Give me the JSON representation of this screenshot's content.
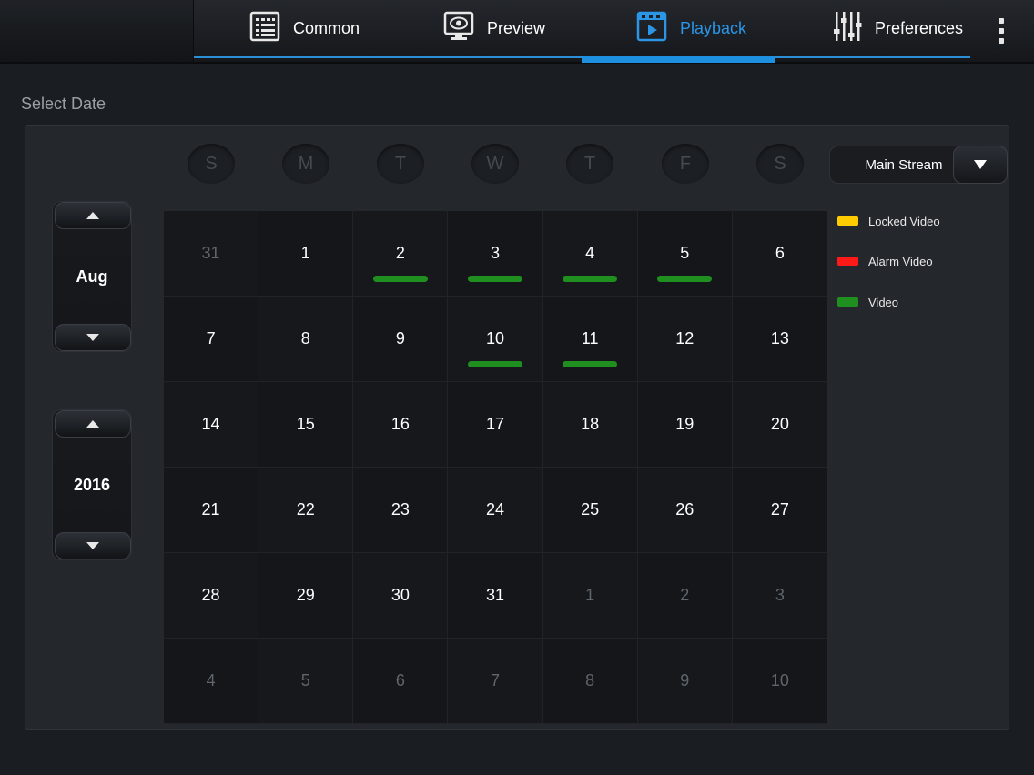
{
  "nav": {
    "tabs": [
      {
        "label": "Common",
        "icon": "grid-list-icon",
        "active": false
      },
      {
        "label": "Preview",
        "icon": "monitor-eye-icon",
        "active": false
      },
      {
        "label": "Playback",
        "icon": "film-play-icon",
        "active": true
      },
      {
        "label": "Preferences",
        "icon": "sliders-icon",
        "active": false
      }
    ],
    "more_icon": "more-vertical-icon"
  },
  "page": {
    "section_label": "Select Date"
  },
  "month_picker": {
    "value": "Aug"
  },
  "year_picker": {
    "value": "2016"
  },
  "weekdays": [
    "S",
    "M",
    "T",
    "W",
    "T",
    "F",
    "S"
  ],
  "stream_select": {
    "value": "Main Stream"
  },
  "legend": [
    {
      "label": "Locked Video",
      "color": "#ffcc00"
    },
    {
      "label": "Alarm Video",
      "color": "#ff1a1a"
    },
    {
      "label": "Video",
      "color": "#1f8f1f"
    }
  ],
  "calendar": {
    "days": [
      {
        "n": "31",
        "other": true
      },
      {
        "n": "1"
      },
      {
        "n": "2",
        "rec": "video"
      },
      {
        "n": "3",
        "rec": "video"
      },
      {
        "n": "4",
        "rec": "video"
      },
      {
        "n": "5",
        "rec": "video"
      },
      {
        "n": "6"
      },
      {
        "n": "7"
      },
      {
        "n": "8"
      },
      {
        "n": "9"
      },
      {
        "n": "10",
        "rec": "video"
      },
      {
        "n": "11",
        "rec": "video"
      },
      {
        "n": "12"
      },
      {
        "n": "13"
      },
      {
        "n": "14"
      },
      {
        "n": "15"
      },
      {
        "n": "16"
      },
      {
        "n": "17"
      },
      {
        "n": "18"
      },
      {
        "n": "19"
      },
      {
        "n": "20"
      },
      {
        "n": "21"
      },
      {
        "n": "22"
      },
      {
        "n": "23"
      },
      {
        "n": "24"
      },
      {
        "n": "25"
      },
      {
        "n": "26"
      },
      {
        "n": "27"
      },
      {
        "n": "28"
      },
      {
        "n": "29"
      },
      {
        "n": "30"
      },
      {
        "n": "31"
      },
      {
        "n": "1",
        "other": true
      },
      {
        "n": "2",
        "other": true
      },
      {
        "n": "3",
        "other": true
      },
      {
        "n": "4",
        "other": true
      },
      {
        "n": "5",
        "other": true
      },
      {
        "n": "6",
        "other": true
      },
      {
        "n": "7",
        "other": true
      },
      {
        "n": "8",
        "other": true
      },
      {
        "n": "9",
        "other": true
      },
      {
        "n": "10",
        "other": true
      }
    ]
  },
  "colors": {
    "accent": "#2b95e6",
    "video": "#1f8f1f",
    "alarm": "#ff1a1a",
    "locked": "#ffcc00"
  }
}
